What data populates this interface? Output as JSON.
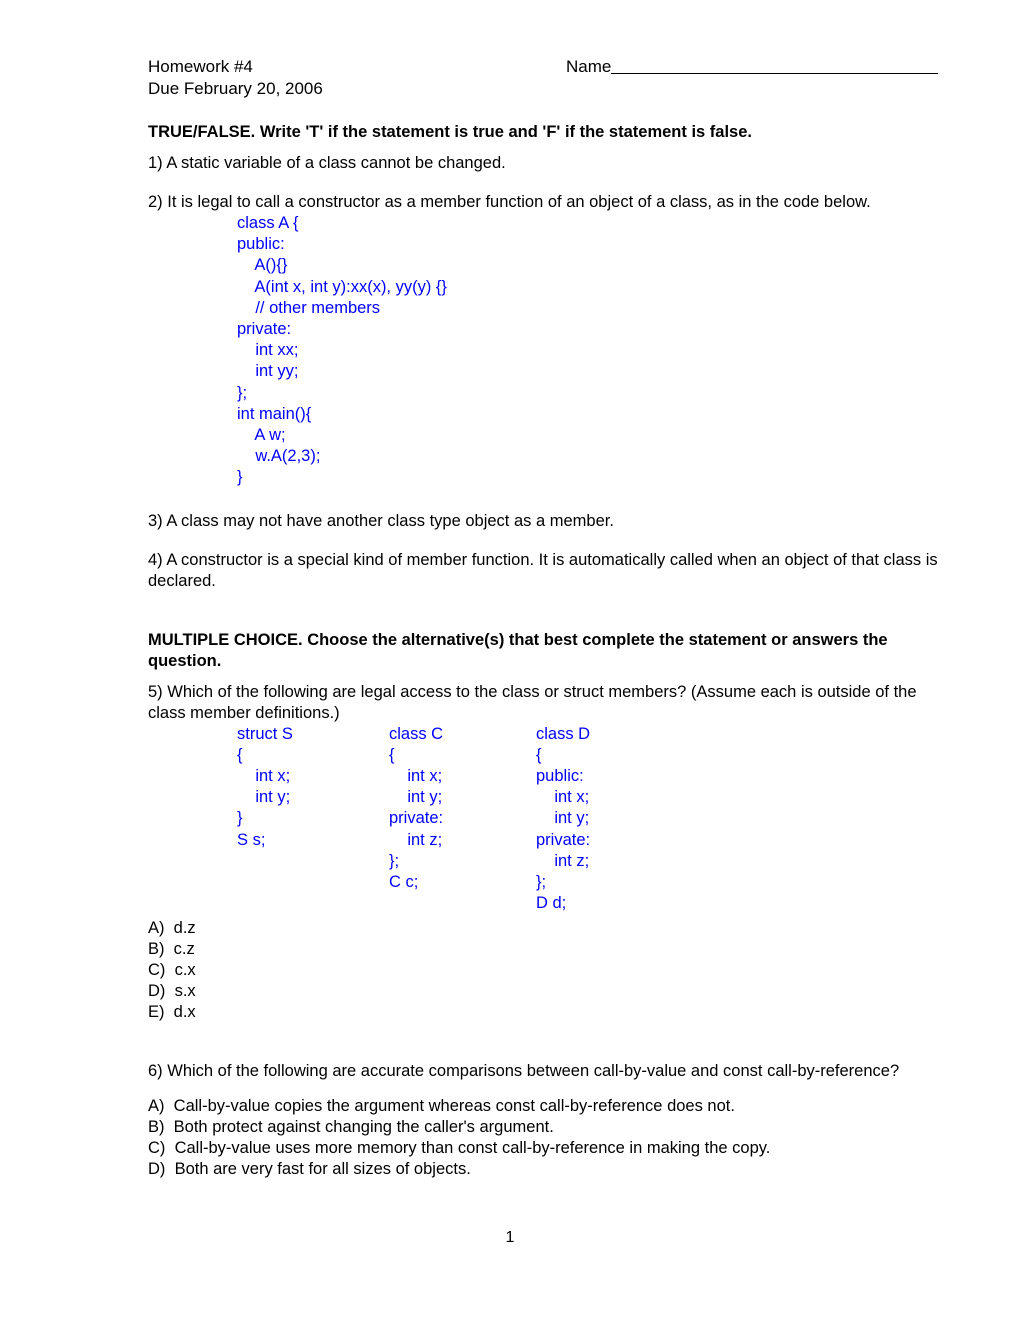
{
  "document": {
    "header": {
      "assignment_title": "Homework #4",
      "due_line": "Due February 20, 2006",
      "name_label": "Name"
    },
    "sections": [
      {
        "heading": "TRUE/FALSE.  Write 'T' if the statement is true and 'F' if the statement is false."
      },
      {
        "heading": "MULTIPLE CHOICE.  Choose the alternative(s) that best complete the statement or answers the question."
      }
    ],
    "questions": [
      {
        "number": "1)",
        "text": "1)  A static variable of a class cannot be changed."
      },
      {
        "number": "2)",
        "text": "2)  It is legal to call a constructor as a member function of an object of a class, as in the code below.",
        "code": "class A {\npublic:\n    A(){}\n    A(int x, int y):xx(x), yy(y) {}\n    // other members\nprivate:\n    int xx;\n    int yy;\n};\nint main(){\n    A w;\n    w.A(2,3);\n}"
      },
      {
        "number": "3)",
        "text": "3)  A class may not have another class type object as a member."
      },
      {
        "number": "4)",
        "text": "4)  A constructor is a special kind of member function. It is automatically called when an object of that class is declared."
      },
      {
        "number": "5)",
        "text": "5)  Which of the following are legal access to the class or struct members? (Assume each is outside of the class member definitions.)",
        "code_columns": [
          "struct S\n{\n    int x;\n    int y;\n}\nS s;",
          "class C\n{\n    int x;\n    int y;\nprivate:\n    int z;\n};\nC c;",
          "class D\n{\npublic:\n    int x;\n    int y;\nprivate:\n    int z;\n};\nD d;"
        ],
        "options": [
          "A)  d.z",
          "B)  c.z",
          "C)  c.x",
          "D)  s.x",
          "E)  d.x"
        ]
      },
      {
        "number": "6)",
        "text": "6)  Which of the following are accurate comparisons between call-by-value and const call-by-reference?",
        "options": [
          "A)  Call-by-value copies the argument whereas const call-by-reference does not.",
          "B)  Both protect against changing the caller's argument.",
          "C)  Call-by-value uses more memory than const call-by-reference in making the copy.",
          "D)  Both are very fast for all sizes of objects."
        ]
      }
    ],
    "footer": {
      "page_number": "1"
    },
    "colors": {
      "code_blue": "#0000FF",
      "text_black": "#000000",
      "background": "#FFFFFF"
    }
  }
}
